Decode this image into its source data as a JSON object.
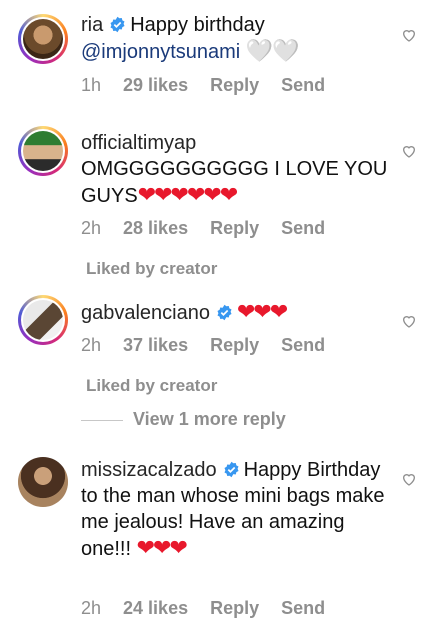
{
  "comments": [
    {
      "username": "ria",
      "verified": true,
      "text_before": "Happy birthday",
      "mention": "@imjonnytsunami",
      "emoji": "🤍🤍",
      "time": "1h",
      "likes": "29 likes",
      "reply": "Reply",
      "send": "Send"
    },
    {
      "username": "officialtimyap",
      "verified": false,
      "text": "OMGGGGGGGGGG I LOVE YOU GUYS",
      "emoji": "❤❤❤❤❤❤",
      "time": "2h",
      "likes": "28 likes",
      "reply": "Reply",
      "send": "Send",
      "liked_by": "Liked by creator"
    },
    {
      "username": "gabvalenciano",
      "verified": true,
      "emoji": "❤❤❤",
      "time": "2h",
      "likes": "37 likes",
      "reply": "Reply",
      "send": "Send",
      "liked_by": "Liked by creator",
      "view_replies": "View 1 more reply"
    },
    {
      "username": "missizacalzado",
      "verified": true,
      "text": "Happy Birthday to the man whose mini bags make me jealous! Have an amazing one!!!",
      "emoji": "❤❤❤",
      "time": "2h",
      "likes": "24 likes",
      "reply": "Reply",
      "send": "Send"
    }
  ],
  "colors": {
    "verified": "#3897f0",
    "heart": "#e8182c",
    "meta": "#8e8e8e",
    "mention": "#1a3a7a"
  },
  "icons": {
    "verified": "verified-badge-icon",
    "like": "heart-outline-icon"
  }
}
